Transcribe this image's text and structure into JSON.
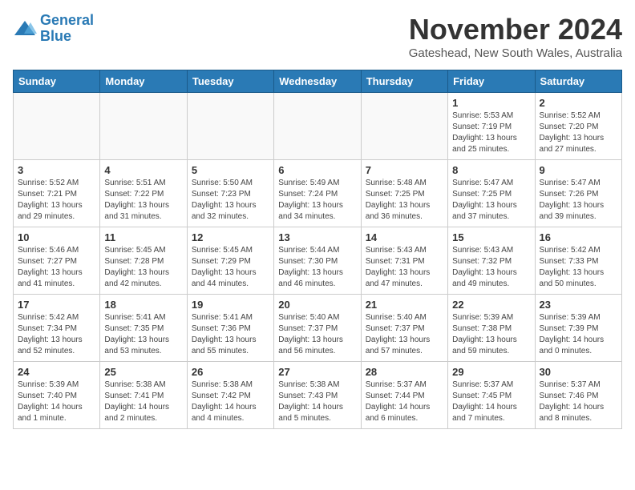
{
  "logo": {
    "line1": "General",
    "line2": "Blue"
  },
  "title": "November 2024",
  "location": "Gateshead, New South Wales, Australia",
  "weekdays": [
    "Sunday",
    "Monday",
    "Tuesday",
    "Wednesday",
    "Thursday",
    "Friday",
    "Saturday"
  ],
  "weeks": [
    [
      {
        "day": "",
        "info": ""
      },
      {
        "day": "",
        "info": ""
      },
      {
        "day": "",
        "info": ""
      },
      {
        "day": "",
        "info": ""
      },
      {
        "day": "",
        "info": ""
      },
      {
        "day": "1",
        "info": "Sunrise: 5:53 AM\nSunset: 7:19 PM\nDaylight: 13 hours\nand 25 minutes."
      },
      {
        "day": "2",
        "info": "Sunrise: 5:52 AM\nSunset: 7:20 PM\nDaylight: 13 hours\nand 27 minutes."
      }
    ],
    [
      {
        "day": "3",
        "info": "Sunrise: 5:52 AM\nSunset: 7:21 PM\nDaylight: 13 hours\nand 29 minutes."
      },
      {
        "day": "4",
        "info": "Sunrise: 5:51 AM\nSunset: 7:22 PM\nDaylight: 13 hours\nand 31 minutes."
      },
      {
        "day": "5",
        "info": "Sunrise: 5:50 AM\nSunset: 7:23 PM\nDaylight: 13 hours\nand 32 minutes."
      },
      {
        "day": "6",
        "info": "Sunrise: 5:49 AM\nSunset: 7:24 PM\nDaylight: 13 hours\nand 34 minutes."
      },
      {
        "day": "7",
        "info": "Sunrise: 5:48 AM\nSunset: 7:25 PM\nDaylight: 13 hours\nand 36 minutes."
      },
      {
        "day": "8",
        "info": "Sunrise: 5:47 AM\nSunset: 7:25 PM\nDaylight: 13 hours\nand 37 minutes."
      },
      {
        "day": "9",
        "info": "Sunrise: 5:47 AM\nSunset: 7:26 PM\nDaylight: 13 hours\nand 39 minutes."
      }
    ],
    [
      {
        "day": "10",
        "info": "Sunrise: 5:46 AM\nSunset: 7:27 PM\nDaylight: 13 hours\nand 41 minutes."
      },
      {
        "day": "11",
        "info": "Sunrise: 5:45 AM\nSunset: 7:28 PM\nDaylight: 13 hours\nand 42 minutes."
      },
      {
        "day": "12",
        "info": "Sunrise: 5:45 AM\nSunset: 7:29 PM\nDaylight: 13 hours\nand 44 minutes."
      },
      {
        "day": "13",
        "info": "Sunrise: 5:44 AM\nSunset: 7:30 PM\nDaylight: 13 hours\nand 46 minutes."
      },
      {
        "day": "14",
        "info": "Sunrise: 5:43 AM\nSunset: 7:31 PM\nDaylight: 13 hours\nand 47 minutes."
      },
      {
        "day": "15",
        "info": "Sunrise: 5:43 AM\nSunset: 7:32 PM\nDaylight: 13 hours\nand 49 minutes."
      },
      {
        "day": "16",
        "info": "Sunrise: 5:42 AM\nSunset: 7:33 PM\nDaylight: 13 hours\nand 50 minutes."
      }
    ],
    [
      {
        "day": "17",
        "info": "Sunrise: 5:42 AM\nSunset: 7:34 PM\nDaylight: 13 hours\nand 52 minutes."
      },
      {
        "day": "18",
        "info": "Sunrise: 5:41 AM\nSunset: 7:35 PM\nDaylight: 13 hours\nand 53 minutes."
      },
      {
        "day": "19",
        "info": "Sunrise: 5:41 AM\nSunset: 7:36 PM\nDaylight: 13 hours\nand 55 minutes."
      },
      {
        "day": "20",
        "info": "Sunrise: 5:40 AM\nSunset: 7:37 PM\nDaylight: 13 hours\nand 56 minutes."
      },
      {
        "day": "21",
        "info": "Sunrise: 5:40 AM\nSunset: 7:37 PM\nDaylight: 13 hours\nand 57 minutes."
      },
      {
        "day": "22",
        "info": "Sunrise: 5:39 AM\nSunset: 7:38 PM\nDaylight: 13 hours\nand 59 minutes."
      },
      {
        "day": "23",
        "info": "Sunrise: 5:39 AM\nSunset: 7:39 PM\nDaylight: 14 hours\nand 0 minutes."
      }
    ],
    [
      {
        "day": "24",
        "info": "Sunrise: 5:39 AM\nSunset: 7:40 PM\nDaylight: 14 hours\nand 1 minute."
      },
      {
        "day": "25",
        "info": "Sunrise: 5:38 AM\nSunset: 7:41 PM\nDaylight: 14 hours\nand 2 minutes."
      },
      {
        "day": "26",
        "info": "Sunrise: 5:38 AM\nSunset: 7:42 PM\nDaylight: 14 hours\nand 4 minutes."
      },
      {
        "day": "27",
        "info": "Sunrise: 5:38 AM\nSunset: 7:43 PM\nDaylight: 14 hours\nand 5 minutes."
      },
      {
        "day": "28",
        "info": "Sunrise: 5:37 AM\nSunset: 7:44 PM\nDaylight: 14 hours\nand 6 minutes."
      },
      {
        "day": "29",
        "info": "Sunrise: 5:37 AM\nSunset: 7:45 PM\nDaylight: 14 hours\nand 7 minutes."
      },
      {
        "day": "30",
        "info": "Sunrise: 5:37 AM\nSunset: 7:46 PM\nDaylight: 14 hours\nand 8 minutes."
      }
    ]
  ]
}
